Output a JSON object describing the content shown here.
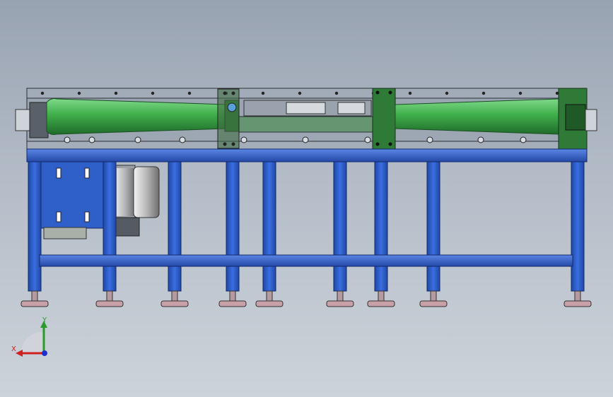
{
  "viewport": {
    "triad": {
      "x_label": "X",
      "y_label": "Y"
    }
  },
  "colors": {
    "frame_blue": "#2f5fc8",
    "roller_green": "#3fae4a",
    "plate_green": "#2f7a36",
    "motor_grey": "#c8c8c8",
    "foot_pink": "#c8a0a8"
  },
  "model": {
    "legs": 9,
    "rollers": 2
  }
}
